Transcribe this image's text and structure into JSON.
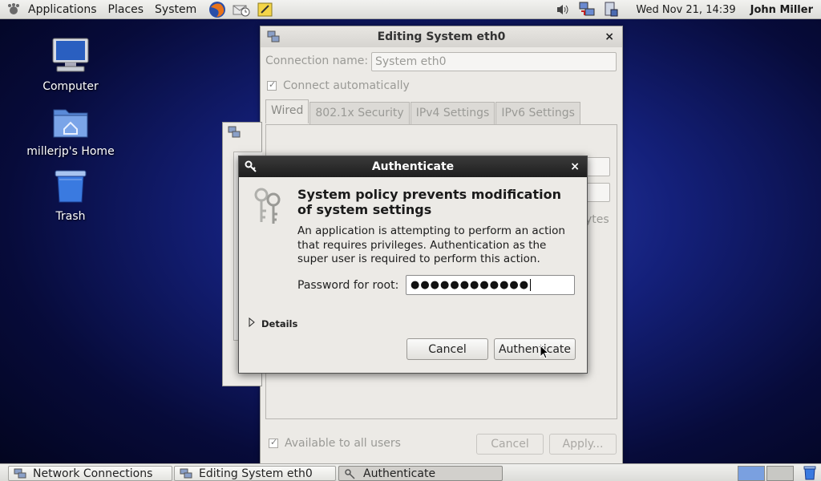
{
  "top_panel": {
    "menus": [
      "Applications",
      "Places",
      "System"
    ],
    "clock": "Wed Nov 21, 14:39",
    "user": "John Miller"
  },
  "desktop": {
    "icons": [
      {
        "label": "Computer",
        "icon": "computer-icon"
      },
      {
        "label": "millerjp's Home",
        "icon": "home-folder-icon"
      },
      {
        "label": "Trash",
        "icon": "trash-icon"
      }
    ]
  },
  "edit_window": {
    "title": "Editing System eth0",
    "connection_name_label": "Connection name:",
    "connection_name_value": "System eth0",
    "connect_automatically": "Connect automatically",
    "tabs": [
      "Wired",
      "802.1x Security",
      "IPv4 Settings",
      "IPv6 Settings"
    ],
    "bytes_fragment": "ytes",
    "available_to_all": "Available to all users",
    "cancel": "Cancel",
    "apply": "Apply..."
  },
  "auth_dialog": {
    "title": "Authenticate",
    "heading": "System policy prevents modification of system settings",
    "body": "An application is attempting to perform an action that requires privileges. Authentication as the super user is required to perform this action.",
    "password_label": "Password for root:",
    "password_mask": "●●●●●●●●●●●●",
    "details": "Details",
    "cancel": "Cancel",
    "authenticate": "Authenticate"
  },
  "taskbar": {
    "tasks": [
      "Network Connections",
      "Editing System eth0",
      "Authenticate"
    ]
  }
}
